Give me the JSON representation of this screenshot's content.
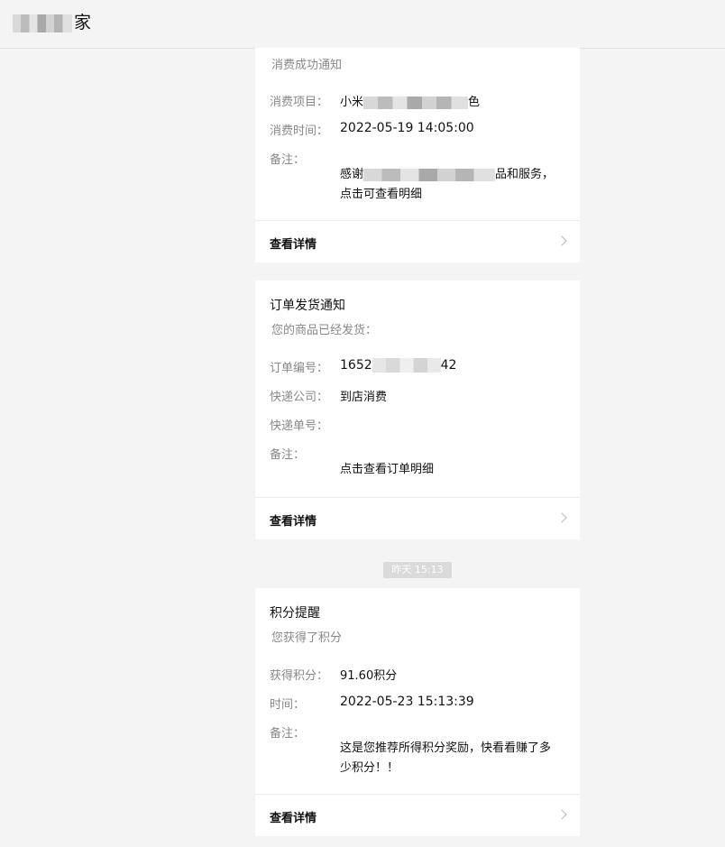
{
  "header": {
    "title_suffix": "家"
  },
  "cards": [
    {
      "subtitle": "消费成功通知",
      "rows": [
        {
          "key": "消费项目：",
          "value_prefix": "小米",
          "value_suffix": "色"
        },
        {
          "key": "消费时间：",
          "value": "2022-05-19 14:05:00"
        },
        {
          "key": "备注："
        }
      ],
      "remark_prefix": "感谢",
      "remark_suffix": "品和服务，",
      "remark_line2": "点击可查看明细",
      "detail_label": "查看详情"
    },
    {
      "title": "订单发货通知",
      "subtitle": "您的商品已经发货：",
      "rows": [
        {
          "key": "订单编号：",
          "value_prefix": "1652",
          "value_suffix": "42"
        },
        {
          "key": "快递公司：",
          "value": "到店消费"
        },
        {
          "key": "快递单号：",
          "value": ""
        },
        {
          "key": "备注："
        }
      ],
      "remark": "点击查看订单明细",
      "detail_label": "查看详情"
    },
    {
      "title": "积分提醒",
      "subtitle": "您获得了积分",
      "rows": [
        {
          "key": "获得积分：",
          "value": "91.60积分"
        },
        {
          "key": "时间：",
          "value": "2022-05-23 15:13:39"
        },
        {
          "key": "备注："
        }
      ],
      "remark": "这是您推荐所得积分奖励，快看看赚了多少积分！！",
      "detail_label": "查看详情"
    }
  ],
  "timestamp": "昨天 15:13",
  "icons": {
    "chevron": "chevron-right-icon"
  }
}
